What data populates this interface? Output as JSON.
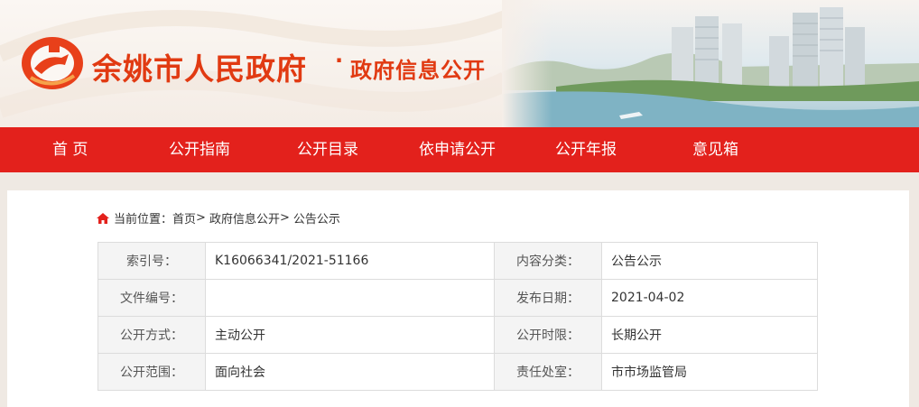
{
  "header": {
    "site_title": "余姚市人民政府",
    "separator": "·",
    "subtitle": "政府信息公开",
    "brand_color": "#e13a12"
  },
  "nav": {
    "color": "#e3211c",
    "items": [
      {
        "label": "首 页"
      },
      {
        "label": "公开指南"
      },
      {
        "label": "公开目录"
      },
      {
        "label": "依申请公开"
      },
      {
        "label": "公开年报"
      },
      {
        "label": "意见箱"
      }
    ]
  },
  "breadcrumb": {
    "prefix": "当前位置：",
    "items": [
      "首页",
      "政府信息公开",
      "公告公示"
    ],
    "sep": ">"
  },
  "meta": {
    "rows": [
      {
        "l1": "索引号：",
        "v1": "K16066341/2021-51166",
        "l2": "内容分类：",
        "v2": "公告公示"
      },
      {
        "l1": "文件编号：",
        "v1": "",
        "l2": "发布日期：",
        "v2": "2021-04-02"
      },
      {
        "l1": "公开方式：",
        "v1": "主动公开",
        "l2": "公开时限：",
        "v2": "长期公开"
      },
      {
        "l1": "公开范围：",
        "v1": "面向社会",
        "l2": "责任处室：",
        "v2": "市市场监管局"
      }
    ]
  }
}
